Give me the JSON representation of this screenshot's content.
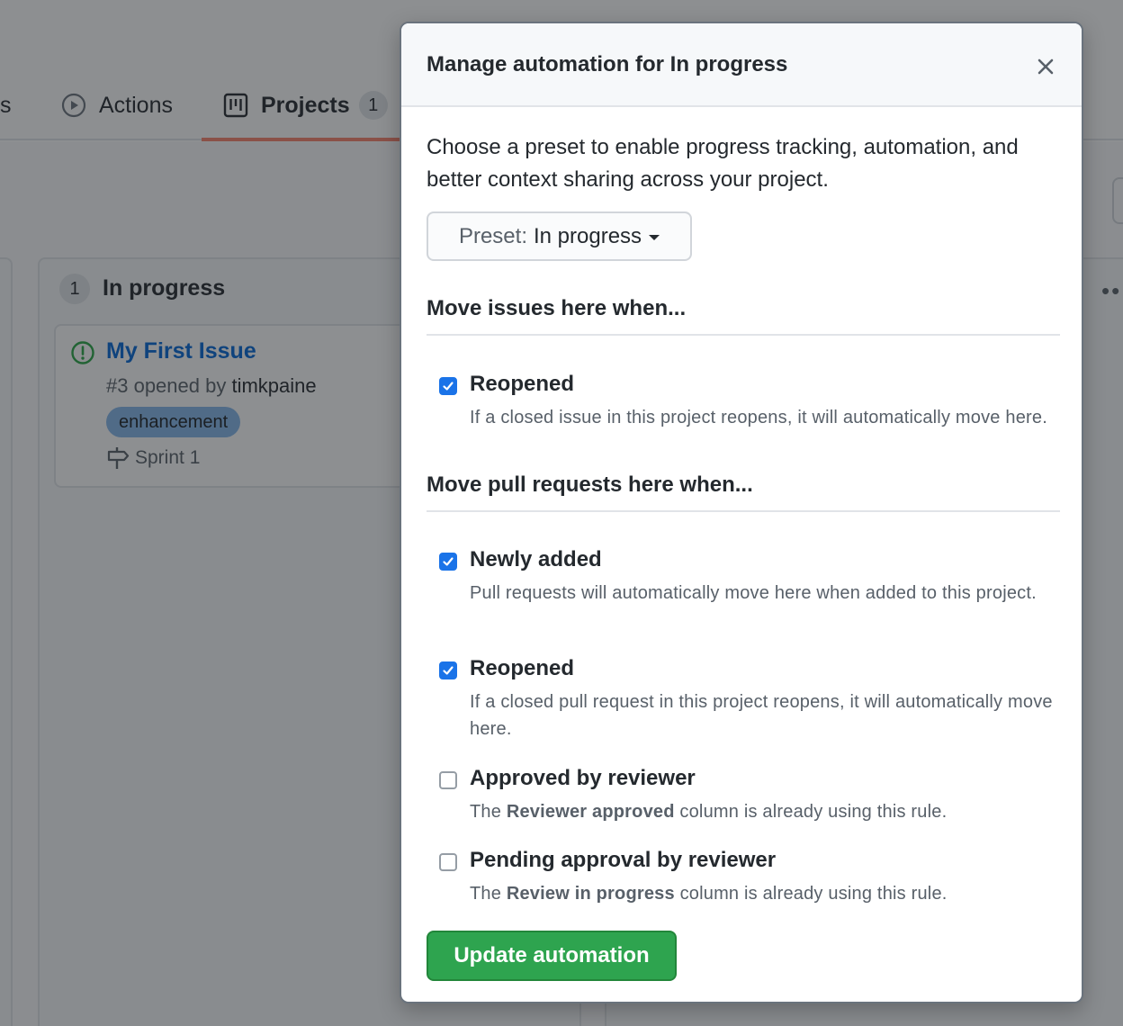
{
  "tabs": {
    "cut_label": "s",
    "actions_label": "Actions",
    "projects_label": "Projects",
    "projects_count": "1"
  },
  "board": {
    "column_count": "1",
    "column_title": "In progress",
    "card": {
      "title": "My First Issue",
      "meta_prefix": "#3 opened by ",
      "author": "timkpaine",
      "label": "enhancement",
      "milestone": "Sprint 1"
    },
    "more_dots": "••"
  },
  "modal": {
    "title": "Manage automation for In progress",
    "intro": "Choose a preset to enable progress tracking, automation, and better context sharing across your project.",
    "preset_label": "Preset:",
    "preset_value": "In progress",
    "issues_heading": "Move issues here when...",
    "issue_rules": [
      {
        "title": "Reopened",
        "desc": "If a closed issue in this project reopens, it will automatically move here.",
        "checked": true
      }
    ],
    "pr_heading": "Move pull requests here when...",
    "pr_rules": [
      {
        "title": "Newly added",
        "desc": "Pull requests will automatically move here when added to this project.",
        "checked": true
      },
      {
        "title": "Reopened",
        "desc": "If a closed pull request in this project reopens, it will automatically move here.",
        "checked": true
      },
      {
        "title": "Approved by reviewer",
        "desc_pre": "The ",
        "desc_bold": "Reviewer approved",
        "desc_post": " column is already using this rule.",
        "checked": false
      },
      {
        "title": "Pending approval by reviewer",
        "desc_pre": "The ",
        "desc_bold": "Review in progress",
        "desc_post": " column is already using this rule.",
        "checked": false
      }
    ],
    "update_label": "Update automation"
  },
  "colors": {
    "accent_green": "#2ea44f",
    "checkbox_blue": "#1a73e8",
    "link_blue": "#0366d6",
    "label_color": "#84b6eb",
    "tab_underline": "#f9826c"
  }
}
